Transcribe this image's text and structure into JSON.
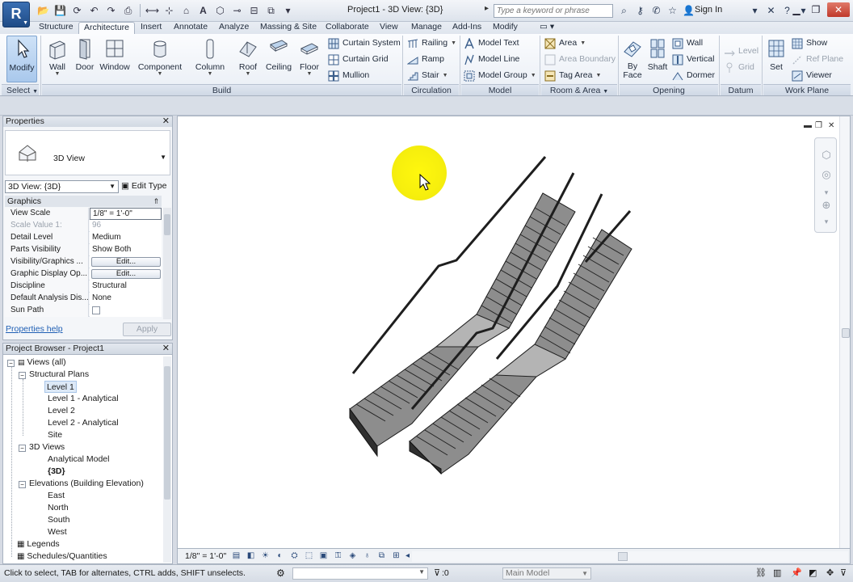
{
  "app": {
    "logo_letter": "R",
    "title": "Project1 - 3D View: {3D}",
    "search_placeholder": "Type a keyword or phrase",
    "sign_in": "Sign In"
  },
  "tabs": [
    "Structure",
    "Architecture",
    "Insert",
    "Annotate",
    "Analyze",
    "Massing & Site",
    "Collaborate",
    "View",
    "Manage",
    "Add-Ins",
    "Modify"
  ],
  "active_tab": "Architecture",
  "ribbon": {
    "select": {
      "modify": "Modify",
      "label": "Select"
    },
    "build": {
      "label": "Build",
      "wall": "Wall",
      "door": "Door",
      "window": "Window",
      "component": "Component",
      "column": "Column",
      "roof": "Roof",
      "ceiling": "Ceiling",
      "floor": "Floor",
      "curtain_system": "Curtain System",
      "curtain_grid": "Curtain Grid",
      "mullion": "Mullion"
    },
    "circulation": {
      "label": "Circulation",
      "railing": "Railing",
      "ramp": "Ramp",
      "stair": "Stair"
    },
    "model": {
      "label": "Model",
      "model_text": "Model Text",
      "model_line": "Model Line",
      "model_group": "Model Group"
    },
    "room_area": {
      "label": "Room & Area",
      "area": "Area",
      "area_boundary": "Area Boundary",
      "tag_area": "Tag Area"
    },
    "opening": {
      "label": "Opening",
      "by_face_1": "By",
      "by_face_2": "Face",
      "shaft": "Shaft",
      "wall": "Wall",
      "vertical": "Vertical",
      "dormer": "Dormer"
    },
    "datum": {
      "label": "Datum",
      "level": "Level",
      "grid": "Grid"
    },
    "work_plane": {
      "label": "Work Plane",
      "set": "Set",
      "show": "Show",
      "ref_plane": "Ref Plane",
      "viewer": "Viewer"
    }
  },
  "properties": {
    "title": "Properties",
    "type_name": "3D View",
    "instance": "3D View: {3D}",
    "edit_type": "Edit Type",
    "group": "Graphics",
    "rows": [
      {
        "key": "View Scale",
        "value": "1/8\" = 1'-0\""
      },
      {
        "key": "Scale Value    1:",
        "value": "96"
      },
      {
        "key": "Detail Level",
        "value": "Medium"
      },
      {
        "key": "Parts Visibility",
        "value": "Show Both"
      },
      {
        "key": "Visibility/Graphics ...",
        "value": "Edit..."
      },
      {
        "key": "Graphic Display Op...",
        "value": "Edit..."
      },
      {
        "key": "Discipline",
        "value": "Structural"
      },
      {
        "key": "Default Analysis Dis...",
        "value": "None"
      },
      {
        "key": "Sun Path",
        "value": ""
      }
    ],
    "help": "Properties help",
    "apply": "Apply"
  },
  "browser": {
    "title": "Project Browser - Project1",
    "nodes": [
      {
        "label": "Views (all)",
        "exp": "-"
      },
      {
        "label": "Structural Plans",
        "exp": "-"
      },
      {
        "label": "Level 1",
        "exp": ""
      },
      {
        "label": "Level 1 - Analytical",
        "exp": ""
      },
      {
        "label": "Level 2",
        "exp": ""
      },
      {
        "label": "Level 2 - Analytical",
        "exp": ""
      },
      {
        "label": "Site",
        "exp": ""
      },
      {
        "label": "3D Views",
        "exp": "-"
      },
      {
        "label": "Analytical Model",
        "exp": ""
      },
      {
        "label": "{3D}",
        "exp": ""
      },
      {
        "label": "Elevations (Building Elevation)",
        "exp": "-"
      },
      {
        "label": "East",
        "exp": ""
      },
      {
        "label": "North",
        "exp": ""
      },
      {
        "label": "South",
        "exp": ""
      },
      {
        "label": "West",
        "exp": ""
      },
      {
        "label": "Legends",
        "exp": ""
      },
      {
        "label": "Schedules/Quantities",
        "exp": ""
      }
    ]
  },
  "view_control": {
    "scale": "1/8\" = 1'-0\""
  },
  "status": {
    "text": "Click to select, TAB for alternates, CTRL adds, SHIFT unselects.",
    "filter_count": ":0",
    "model": "Main Model"
  },
  "colors": {
    "accent": "#1f4b86",
    "highlight": "#fff700",
    "stair": "#7c7c7c"
  }
}
